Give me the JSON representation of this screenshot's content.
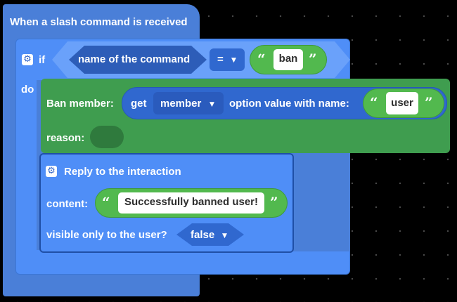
{
  "event_block": {
    "label": "When a slash command is received"
  },
  "if_block": {
    "if_label": "if",
    "do_label": "do",
    "condition": {
      "left_label": "name of the command",
      "operator": "=",
      "right_value": "ban"
    }
  },
  "ban_block": {
    "label": "Ban member:",
    "get_label": "get",
    "member_dropdown": "member",
    "option_label": "option value with name:",
    "option_value": "user",
    "reason_label": "reason:"
  },
  "reply_block": {
    "title": "Reply to the interaction",
    "content_label": "content:",
    "content_value": "Successfully banned user!",
    "visible_label": "visible only to the user?",
    "visible_value": "false"
  },
  "glyphs": {
    "open_quote": "“",
    "close_quote": "”",
    "dropdown_caret": "▼",
    "gear": "⚙"
  },
  "colors": {
    "background": "#000000",
    "event_block": "#4a7fd8",
    "if_block": "#4f8ef7",
    "ban_block": "#3f9d4f",
    "text_input_pill": "#52b94e",
    "reply_border": "#1f4fa6"
  }
}
